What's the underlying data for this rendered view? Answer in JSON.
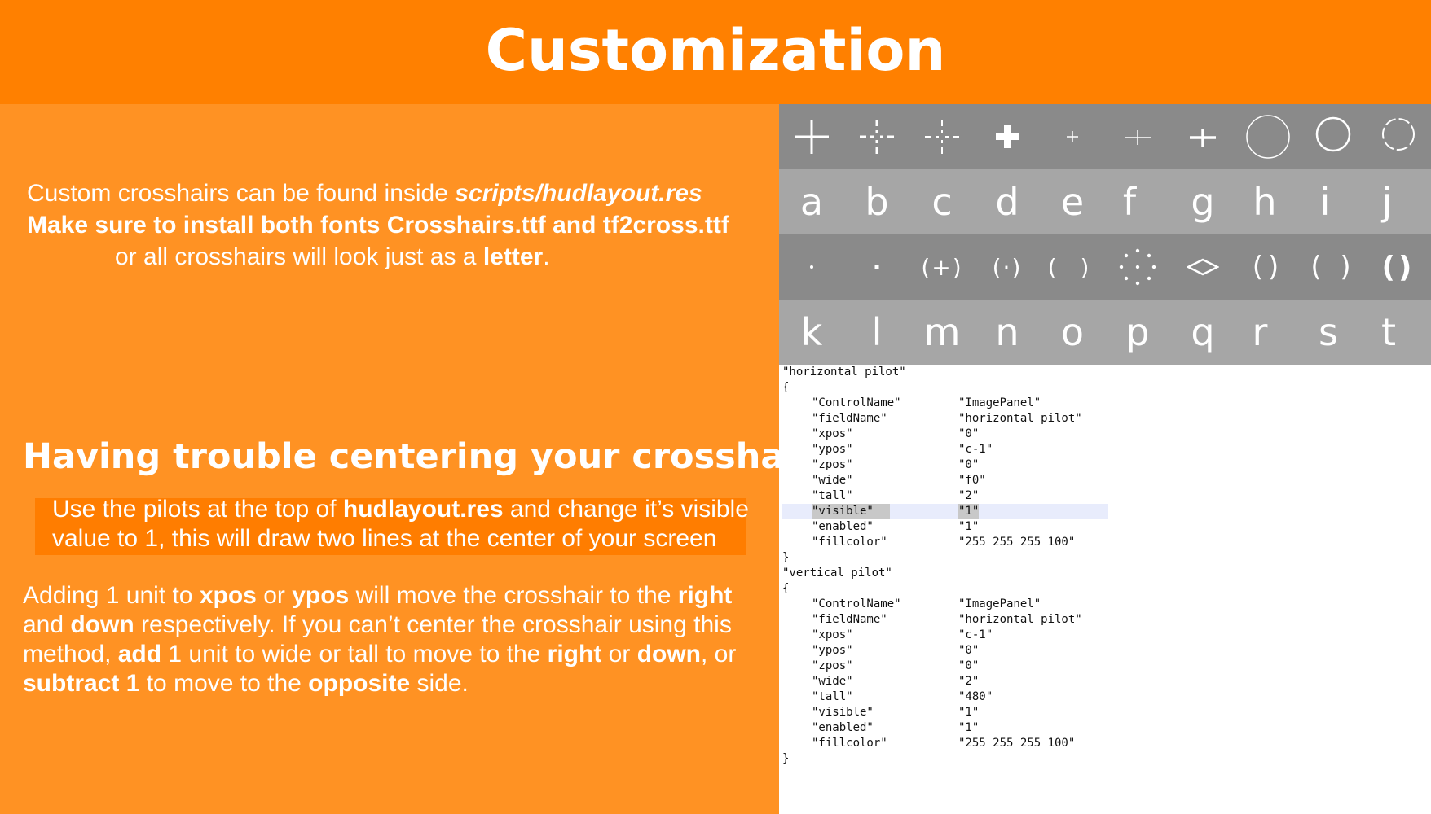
{
  "title": "Customization",
  "intro": {
    "line1_a": "Custom crosshairs can be found inside ",
    "line1_b": "scripts/hudlayout.res",
    "line2_a": "Make sure to install both fonts ",
    "line2_b": "Crosshairs.ttf",
    "line2_c": " and ",
    "line2_d": "tf2cross.ttf",
    "line3_a": "or all crosshairs will look just as a ",
    "line3_b": "letter",
    "line3_c": "."
  },
  "trouble_heading": "Having trouble centering your crosshair?",
  "pilot_note": {
    "line1_a": "Use the pilots at the top of ",
    "line1_b": "hudlayout.res",
    "line1_c": " and change it’s visible",
    "line2": "value to 1, this will draw two lines at the center of your screen"
  },
  "adding_note": {
    "l1_a": "Adding 1 unit to ",
    "l1_b": "xpos",
    "l1_c": " or ",
    "l1_d": "ypos",
    "l1_e": " will move the crosshair to the ",
    "l1_f": "right",
    "l2_a": "and ",
    "l2_b": "down",
    "l2_c": " respectively. If you can’t center the crosshair using this",
    "l3_a": "method, ",
    "l3_b": "add",
    "l3_c": " 1 unit to wide or tall to move to the ",
    "l3_d": "right",
    "l3_e": " or ",
    "l3_f": "down",
    "l3_g": ", or",
    "l4_a": "subtract 1",
    "l4_b": " to move to the ",
    "l4_c": "opposite",
    "l4_d": " side."
  },
  "crosshair_letters_row1": [
    "a",
    "b",
    "c",
    "d",
    "e",
    "f",
    "g",
    "h",
    "i",
    "j"
  ],
  "crosshair_letters_row2": [
    "k",
    "l",
    "m",
    "n",
    "o",
    "p",
    "q",
    "r",
    "s",
    "t"
  ],
  "crosshair_glyphs_row2": {
    "m": "(+)",
    "n": "(·)",
    "o": "( )",
    "r": "()",
    "s": "( )",
    "t": "()"
  },
  "code": {
    "lines": [
      {
        "t": "\"horizontal pilot\""
      },
      {
        "t": "{"
      },
      {
        "k": "\"ControlName\"",
        "v": "\"ImagePanel\""
      },
      {
        "k": "\"fieldName\"",
        "v": "\"horizontal pilot\""
      },
      {
        "k": "\"xpos\"",
        "v": "\"0\""
      },
      {
        "k": "\"ypos\"",
        "v": "\"c-1\""
      },
      {
        "k": "\"zpos\"",
        "v": "\"0\""
      },
      {
        "k": "\"wide\"",
        "v": "\"f0\""
      },
      {
        "k": "\"tall\"",
        "v": "\"2\""
      },
      {
        "k": "\"visible\"",
        "v": "\"1\"",
        "hl": true
      },
      {
        "k": "\"enabled\"",
        "v": "\"1\""
      },
      {
        "k": "\"fillcolor\"",
        "v": "\"255 255 255 100\""
      },
      {
        "t": "}"
      },
      {
        "t": "\"vertical pilot\""
      },
      {
        "t": "{"
      },
      {
        "k": "\"ControlName\"",
        "v": "\"ImagePanel\""
      },
      {
        "k": "\"fieldName\"",
        "v": "\"horizontal pilot\""
      },
      {
        "k": "\"xpos\"",
        "v": "\"c-1\""
      },
      {
        "k": "\"ypos\"",
        "v": "\"0\""
      },
      {
        "k": "\"zpos\"",
        "v": "\"0\""
      },
      {
        "k": "\"wide\"",
        "v": "\"2\""
      },
      {
        "k": "\"tall\"",
        "v": "\"480\""
      },
      {
        "k": "\"visible\"",
        "v": "\"1\""
      },
      {
        "k": "\"enabled\"",
        "v": "\"1\""
      },
      {
        "k": "\"fillcolor\"",
        "v": "\"255 255 255 100\""
      },
      {
        "t": "}"
      }
    ]
  },
  "colors": {
    "header": "#ff8000",
    "panel": "#ff9223",
    "highlight_box": "#ff7d00",
    "grid_dark": "#8a8a8a",
    "grid_light": "#a6a6a6"
  }
}
